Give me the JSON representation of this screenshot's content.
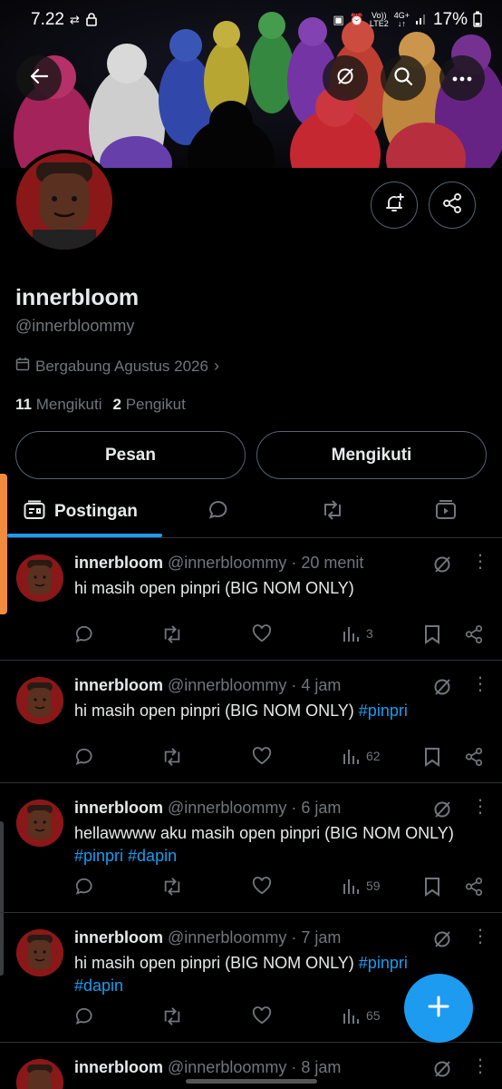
{
  "status_bar": {
    "time": "7.22",
    "battery": "17%",
    "net_top": "Vo))",
    "net_bottom": "LTE2",
    "net2_top": "4G+",
    "net2_bottom": "↓↑"
  },
  "profile": {
    "name": "innerbloom",
    "handle": "@innerbloommy",
    "joined": "Bergabung Agustus 2026",
    "following_count": "11",
    "following_label": "Mengikuti",
    "followers_count": "2",
    "followers_label": "Pengikut"
  },
  "buttons": {
    "message": "Pesan",
    "follow": "Mengikuti"
  },
  "tabs": {
    "posts": "Postingan"
  },
  "posts": [
    {
      "name": "innerbloom",
      "meta": "@innerbloommy · 20 menit",
      "text": "hi masih open pinpri (BIG NOM ONLY)",
      "tags": "",
      "views": "3"
    },
    {
      "name": "innerbloom",
      "meta": "@innerbloommy · 4 jam",
      "text": "hi masih open pinpri (BIG NOM ONLY)",
      "tags": "#pinpri",
      "views": "62"
    },
    {
      "name": "innerbloom",
      "meta": "@innerbloommy · 6 jam",
      "text": "hellawwww aku masih open pinpri (BIG NOM ONLY)",
      "tags": "#pinpri #dapin",
      "views": "59"
    },
    {
      "name": "innerbloom",
      "meta": "@innerbloommy · 7 jam",
      "text": "hi masih open pinpri (BIG NOM ONLY)",
      "tags_inline": "#pinpri",
      "tags": "#dapin",
      "views": "65"
    },
    {
      "name": "innerbloom",
      "meta": "@innerbloommy · 8 jam"
    }
  ],
  "colors": {
    "accent": "#1d9bf0",
    "background": "#000000",
    "muted": "#71767b",
    "divider": "#2f3336"
  }
}
